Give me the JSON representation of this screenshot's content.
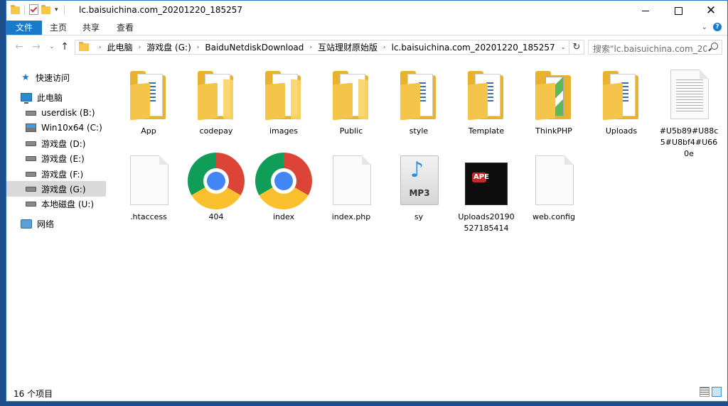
{
  "window": {
    "title": "lc.baisuichina.com_20201220_185257"
  },
  "ribbon": {
    "tabs": [
      "文件",
      "主页",
      "共享",
      "查看"
    ]
  },
  "address": {
    "crumbs": [
      "此电脑",
      "游戏盘 (G:)",
      "BaiduNetdiskDownload",
      "互站理财原始版",
      "lc.baisuichina.com_20201220_185257"
    ]
  },
  "search": {
    "placeholder": "搜索\"lc.baisuichina.com_20..."
  },
  "sidebar": {
    "items": [
      {
        "label": "快速访问",
        "icon": "star-icon"
      },
      {
        "label": "此电脑",
        "icon": "pc-icon"
      },
      {
        "label": "userdisk (B:)",
        "icon": "drive-icon"
      },
      {
        "label": "Win10x64 (C:)",
        "icon": "windows-drive-icon"
      },
      {
        "label": "游戏盘 (D:)",
        "icon": "drive-icon"
      },
      {
        "label": "游戏盘 (E:)",
        "icon": "drive-icon"
      },
      {
        "label": "游戏盘 (F:)",
        "icon": "drive-icon"
      },
      {
        "label": "游戏盘 (G:)",
        "icon": "drive-icon",
        "selected": true
      },
      {
        "label": "本地磁盘 (U:)",
        "icon": "drive-icon"
      },
      {
        "label": "网络",
        "icon": "network-icon"
      }
    ]
  },
  "files": [
    {
      "name": "App",
      "icon": "folder-icon"
    },
    {
      "name": "codepay",
      "icon": "folder-icon"
    },
    {
      "name": "images",
      "icon": "folder-icon"
    },
    {
      "name": "Public",
      "icon": "folder-icon"
    },
    {
      "name": "style",
      "icon": "folder-icon"
    },
    {
      "name": "Template",
      "icon": "folder-icon"
    },
    {
      "name": "ThinkPHP",
      "icon": "folder-icon"
    },
    {
      "name": "Uploads",
      "icon": "folder-icon"
    },
    {
      "name": "#U5b89#U88c5#U8bf4#U660e",
      "icon": "text-document-icon"
    },
    {
      "name": ".htaccess",
      "icon": "blank-file-icon"
    },
    {
      "name": "404",
      "icon": "chrome-html-icon"
    },
    {
      "name": "index",
      "icon": "chrome-html-icon"
    },
    {
      "name": "index.php",
      "icon": "blank-file-icon"
    },
    {
      "name": "sy",
      "icon": "mp3-file-icon"
    },
    {
      "name": "Uploads20190527185414",
      "icon": "image-thumbnail-icon"
    },
    {
      "name": "web.config",
      "icon": "blank-file-icon"
    }
  ],
  "icons": {
    "mp3_label": "MP3",
    "thumbnail_text": "APE"
  },
  "status": {
    "count": "16 个项目"
  }
}
